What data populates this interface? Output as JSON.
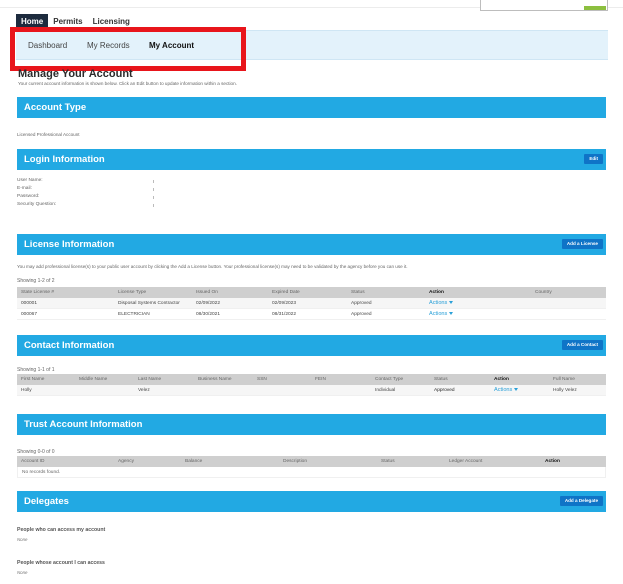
{
  "colors": {
    "section_bar": "#22a9e3",
    "section_button": "#0f74c7",
    "active_tab": "#1d2b3e",
    "subnav_bg": "#e3f2fb",
    "highlight_border": "#e8151b",
    "link": "#2aa0d8",
    "table_header": "#cfcfcf"
  },
  "main_tabs": [
    {
      "label": "Home",
      "active": true
    },
    {
      "label": "Permits",
      "active": false
    },
    {
      "label": "Licensing",
      "active": false
    }
  ],
  "sub_nav": [
    {
      "label": "Dashboard",
      "active": false
    },
    {
      "label": "My Records",
      "active": false
    },
    {
      "label": "My Account",
      "active": true
    }
  ],
  "page": {
    "title": "Manage Your Account",
    "description": "Your current account information is shown below. Click an Edit button to update information within a section."
  },
  "account_type": {
    "title": "Account Type",
    "value": "Licensed Professional Account"
  },
  "login_info": {
    "title": "Login Information",
    "edit_label": "Edit",
    "fields": [
      {
        "label": "User Name:"
      },
      {
        "label": "E-mail:"
      },
      {
        "label": "Password:"
      },
      {
        "label": "Security Question:"
      }
    ]
  },
  "license_info": {
    "title": "License Information",
    "add_label": "Add a License",
    "note": "You may add professional license(s) to your public user account by clicking the Add a License button. Your professional license(s) may need to be validated by the agency before you can use it.",
    "showing": "Showing 1-2 of 2",
    "columns": [
      "State License #",
      "License Type",
      "Issued On",
      "Expired Date",
      "Status",
      "Action",
      "Country"
    ],
    "rows": [
      {
        "license_no": "000001",
        "type": "Disposal Systems Contractor",
        "issued": "02/09/2022",
        "expired": "02/09/2023",
        "status": "Approved",
        "action": "Actions",
        "country": ""
      },
      {
        "license_no": "000067",
        "type": "ELECTRICIAN",
        "issued": "08/30/2021",
        "expired": "08/31/2022",
        "status": "Approved",
        "action": "Actions",
        "country": ""
      }
    ]
  },
  "contact_info": {
    "title": "Contact Information",
    "add_label": "Add a Contact",
    "showing": "Showing 1-1 of 1",
    "columns": [
      "First Name",
      "Middle Name",
      "Last Name",
      "Business Name",
      "SSN",
      "FEIN",
      "Contact Type",
      "Status",
      "Action",
      "Full Name"
    ],
    "rows": [
      {
        "first": "Holly",
        "middle": "",
        "last": "Velez",
        "business": "",
        "ssn": "",
        "fein": "",
        "contact_type": "Individual",
        "status": "Approved",
        "action": "Actions",
        "full_name": "Holly Velez"
      }
    ]
  },
  "trust_account": {
    "title": "Trust Account Information",
    "showing": "Showing 0-0 of 0",
    "columns": [
      "Account ID",
      "Agency",
      "Balance",
      "Description",
      "Status",
      "Ledger Account",
      "Action"
    ],
    "empty_message": "No records found."
  },
  "delegates": {
    "title": "Delegates",
    "add_label": "Add a Delegate",
    "who_can_access_label": "People who can access my account",
    "who_can_access_value": "None",
    "i_can_access_label": "People whose account I can access",
    "i_can_access_value": "None"
  }
}
